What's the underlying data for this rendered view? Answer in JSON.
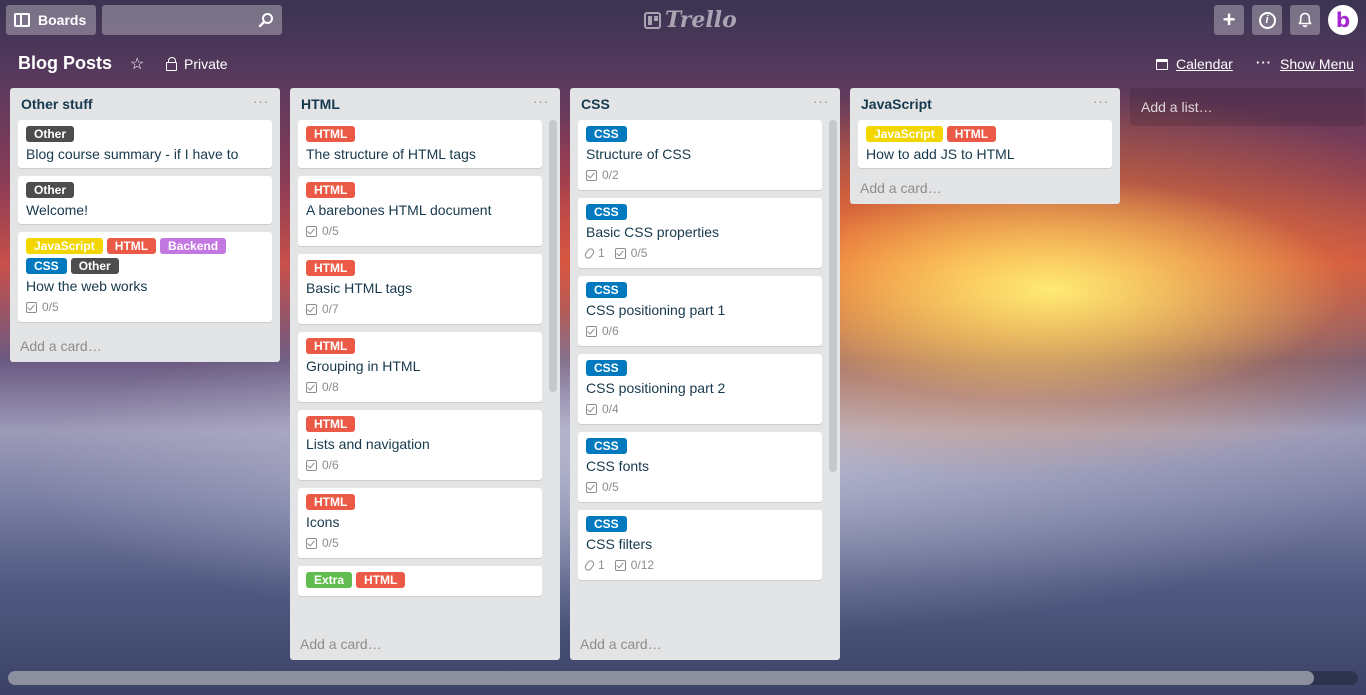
{
  "header": {
    "boards_label": "Boards",
    "search_value": "",
    "logo_text": "Trello"
  },
  "board": {
    "title": "Blog Posts",
    "privacy": "Private",
    "calendar_label": "Calendar",
    "menu_label": "Show Menu"
  },
  "label_colors": {
    "Other": "#4d4d4d",
    "HTML": "#eb5a46",
    "JavaScript": "#f2d600",
    "Backend": "#c377e0",
    "CSS": "#0079bf",
    "Extra": "#61bd4f"
  },
  "lists": [
    {
      "title": "Other stuff",
      "add_card": "Add a card…",
      "cards": [
        {
          "labels": [
            "Other"
          ],
          "title": "Blog course summary - if I have to"
        },
        {
          "labels": [
            "Other"
          ],
          "title": "Welcome!"
        },
        {
          "labels": [
            "JavaScript",
            "HTML",
            "Backend",
            "CSS",
            "Other"
          ],
          "title": "How the web works",
          "checklist": "0/5"
        }
      ]
    },
    {
      "title": "HTML",
      "add_card": "Add a card…",
      "cards": [
        {
          "labels": [
            "HTML"
          ],
          "title": "The structure of HTML tags"
        },
        {
          "labels": [
            "HTML"
          ],
          "title": "A barebones HTML document",
          "checklist": "0/5"
        },
        {
          "labels": [
            "HTML"
          ],
          "title": "Basic HTML tags",
          "checklist": "0/7"
        },
        {
          "labels": [
            "HTML"
          ],
          "title": "Grouping in HTML",
          "checklist": "0/8"
        },
        {
          "labels": [
            "HTML"
          ],
          "title": "Lists and navigation",
          "checklist": "0/6"
        },
        {
          "labels": [
            "HTML"
          ],
          "title": "Icons",
          "checklist": "0/5"
        },
        {
          "labels": [
            "Extra",
            "HTML"
          ],
          "title": ""
        }
      ]
    },
    {
      "title": "CSS",
      "add_card": "Add a card…",
      "cards": [
        {
          "labels": [
            "CSS"
          ],
          "title": "Structure of CSS",
          "checklist": "0/2"
        },
        {
          "labels": [
            "CSS"
          ],
          "title": "Basic CSS properties",
          "attachments": "1",
          "checklist": "0/5"
        },
        {
          "labels": [
            "CSS"
          ],
          "title": "CSS positioning part 1",
          "checklist": "0/6"
        },
        {
          "labels": [
            "CSS"
          ],
          "title": "CSS positioning part 2",
          "checklist": "0/4"
        },
        {
          "labels": [
            "CSS"
          ],
          "title": "CSS fonts",
          "checklist": "0/5"
        },
        {
          "labels": [
            "CSS"
          ],
          "title": "CSS filters",
          "attachments": "1",
          "checklist": "0/12"
        }
      ]
    },
    {
      "title": "JavaScript",
      "add_card": "Add a card…",
      "cards": [
        {
          "labels": [
            "JavaScript",
            "HTML"
          ],
          "title": "How to add JS to HTML"
        }
      ]
    }
  ],
  "add_list": "Add a list…"
}
